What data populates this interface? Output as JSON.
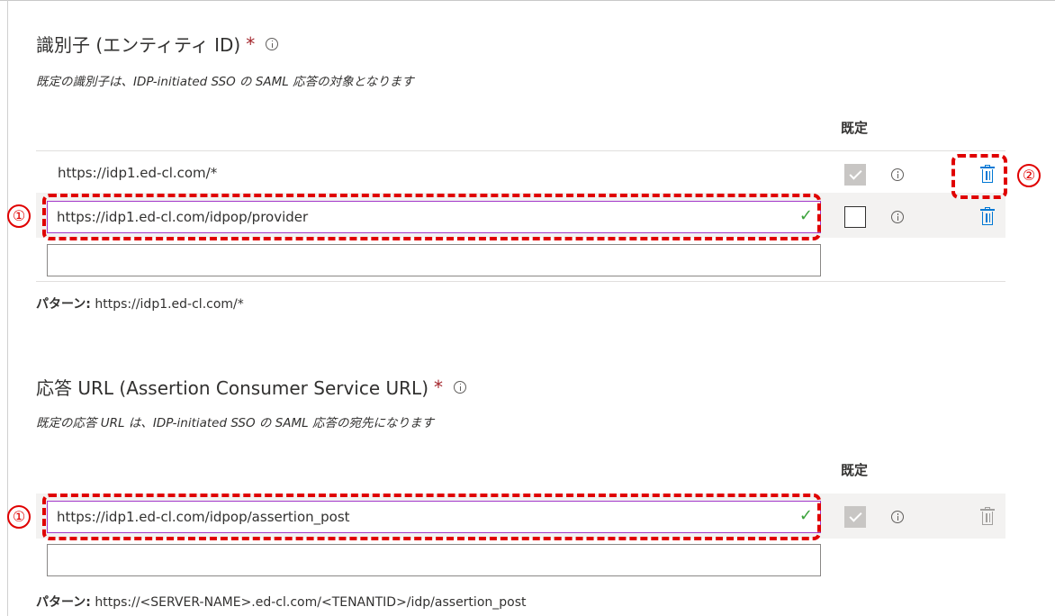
{
  "identifier": {
    "title": "識別子 (エンティティ ID)",
    "required_mark": "*",
    "description": "既定の識別子は、IDP-initiated SSO の SAML 応答の対象となります",
    "default_header": "既定",
    "rows": [
      {
        "value": "https://idp1.ed-cl.com/*",
        "default_checked": true
      },
      {
        "value": "https://idp1.ed-cl.com/idpop/provider",
        "default_checked": false
      }
    ],
    "empty_input_value": "",
    "pattern_label": "パターン:",
    "pattern_value": " https://idp1.ed-cl.com/*"
  },
  "reply_url": {
    "title": "応答 URL (Assertion Consumer Service URL)",
    "required_mark": "*",
    "description": "既定の応答 URL は、IDP-initiated SSO の SAML 応答の宛先になります",
    "default_header": "既定",
    "rows": [
      {
        "value": "https://idp1.ed-cl.com/idpop/assertion_post",
        "default_checked": true
      }
    ],
    "empty_input_value": "",
    "pattern_label": "パターン:",
    "pattern_value": " https://<SERVER-NAME>.ed-cl.com/<TENANTID>/idp/assertion_post"
  },
  "annotations": {
    "badge_1": "①",
    "badge_2": "②",
    "annotation_color": "#e00000"
  },
  "icons": {
    "info": "info-icon",
    "delete": "trash-icon",
    "valid": "checkmark-icon",
    "check_glyph": "✓"
  },
  "colors": {
    "delete_active": "#0078d4",
    "delete_disabled": "#a19f9d",
    "input_focus_border": "#a238c9",
    "valid_check": "#3aa23a",
    "required": "#a4262c"
  }
}
